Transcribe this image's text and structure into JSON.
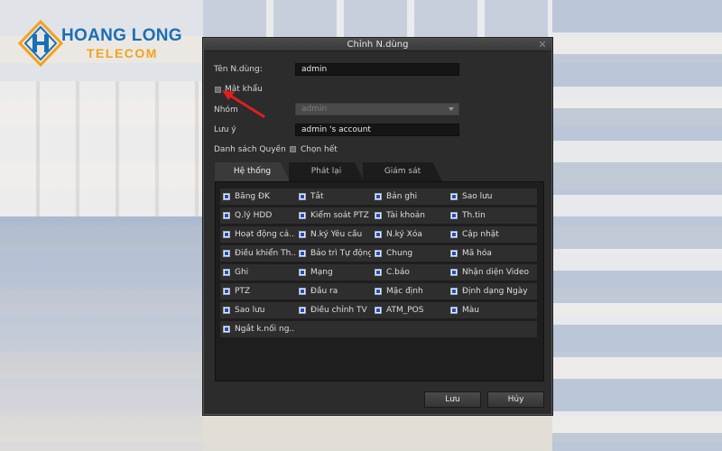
{
  "brand": {
    "name_line1": "HOANG LONG",
    "name_line2": "TELECOM",
    "blue": "#1b6fb5",
    "orange": "#f2a21b"
  },
  "dialog": {
    "title": "Chỉnh N.dùng",
    "close_glyph": "✕",
    "username_label": "Tên N.dùng:",
    "username_value": "admin",
    "password_label": "Mật khẩu",
    "group_label": "Nhóm",
    "group_value": "admin",
    "note_label": "Lưu ý",
    "note_value": "admin 's account",
    "permission_list_label": "Danh sách Quyền",
    "select_all_label": "Chọn hết"
  },
  "tabs": [
    {
      "label": "Hệ thống",
      "active": true
    },
    {
      "label": "Phát lại",
      "active": false
    },
    {
      "label": "Giám sát",
      "active": false
    }
  ],
  "permissions": [
    [
      "Băng ĐK",
      "Tắt",
      "Bản ghi",
      "Sao lưu"
    ],
    [
      "Q.lý HDD",
      "Kiểm soát PTZ",
      "Tài khoản",
      "Th.tin"
    ],
    [
      "Hoạt động cả...",
      "N.ký Yêu cầu",
      "N.ký Xóa",
      "Cập nhật"
    ],
    [
      "Điều khiển Th...",
      "Bảo trì Tự động",
      "Chung",
      "Mã hóa"
    ],
    [
      "Ghi",
      "Mạng",
      "C.báo",
      "Nhận diện Video"
    ],
    [
      "PTZ",
      "Đầu ra",
      "Mặc định",
      "Định dạng Ngày"
    ],
    [
      "Sao lưu",
      "Điều chỉnh TV",
      "ATM_POS",
      "Màu"
    ],
    [
      "Ngắt k.nối ng..."
    ]
  ],
  "buttons": {
    "save": "Lưu",
    "cancel": "Hủy"
  },
  "colors": {
    "dialog_bg": "#2c2c2c",
    "panel_bg": "#1e1e1e",
    "checkbox_fill": "#1f4fbf",
    "annotation": "#e01e1e"
  }
}
